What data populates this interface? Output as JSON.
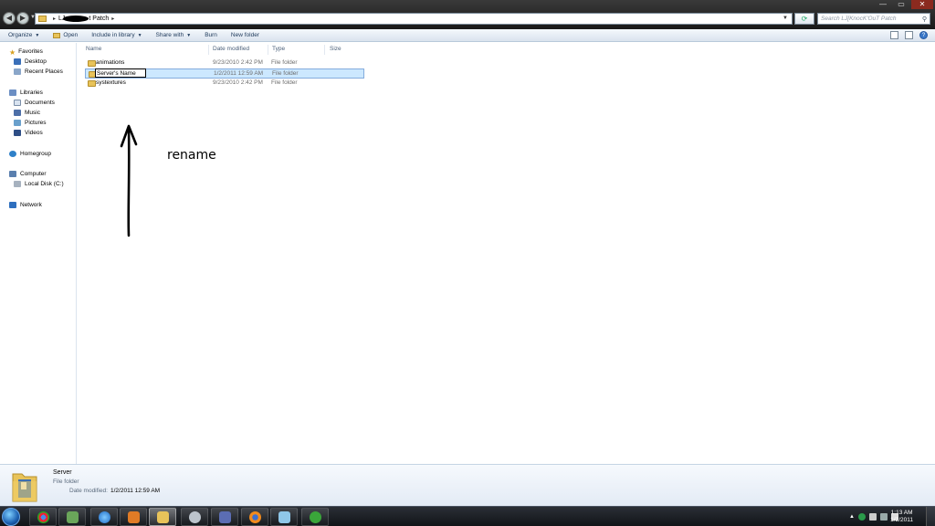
{
  "window": {
    "minimize_symbol": "—",
    "maximize_symbol": "▭",
    "close_symbol": "✕"
  },
  "address": {
    "crumb_prefix": "LJ",
    "crumb_current": "t Patch",
    "search_placeholder": "Search LJ[KnocK'OuT Patch"
  },
  "toolbar": {
    "organize": "Organize",
    "open": "Open",
    "include_in_library": "Include in library",
    "share_with": "Share with",
    "burn": "Burn",
    "new_folder": "New folder"
  },
  "nav": {
    "favorites": "Favorites",
    "desktop": "Desktop",
    "recent_places": "Recent Places",
    "libraries": "Libraries",
    "documents": "Documents",
    "music": "Music",
    "pictures": "Pictures",
    "videos": "Videos",
    "homegroup": "Homegroup",
    "computer": "Computer",
    "local_disk": "Local Disk (C:)",
    "network": "Network"
  },
  "columns": {
    "name": "Name",
    "date_modified": "Date modified",
    "type": "Type",
    "size": "Size"
  },
  "files": [
    {
      "name": "animations",
      "date": "9/23/2010 2:42 PM",
      "type": "File folder"
    },
    {
      "name": "Server's Name",
      "date": "1/2/2011 12:59 AM",
      "type": "File folder"
    },
    {
      "name": "systextures",
      "date": "9/23/2010 2:42 PM",
      "type": "File folder"
    }
  ],
  "annotation": {
    "text": "rename"
  },
  "details": {
    "name": "Server",
    "type": "File folder",
    "date_label": "Date modified:",
    "date_value": "1/2/2011 12:59 AM"
  },
  "clock": {
    "time": "1:13 AM",
    "date": "1/2/2011"
  },
  "colors": {
    "selection_bg": "#cce8ff",
    "selection_border": "#84acdd",
    "folder_yellow": "#e8c35a"
  }
}
